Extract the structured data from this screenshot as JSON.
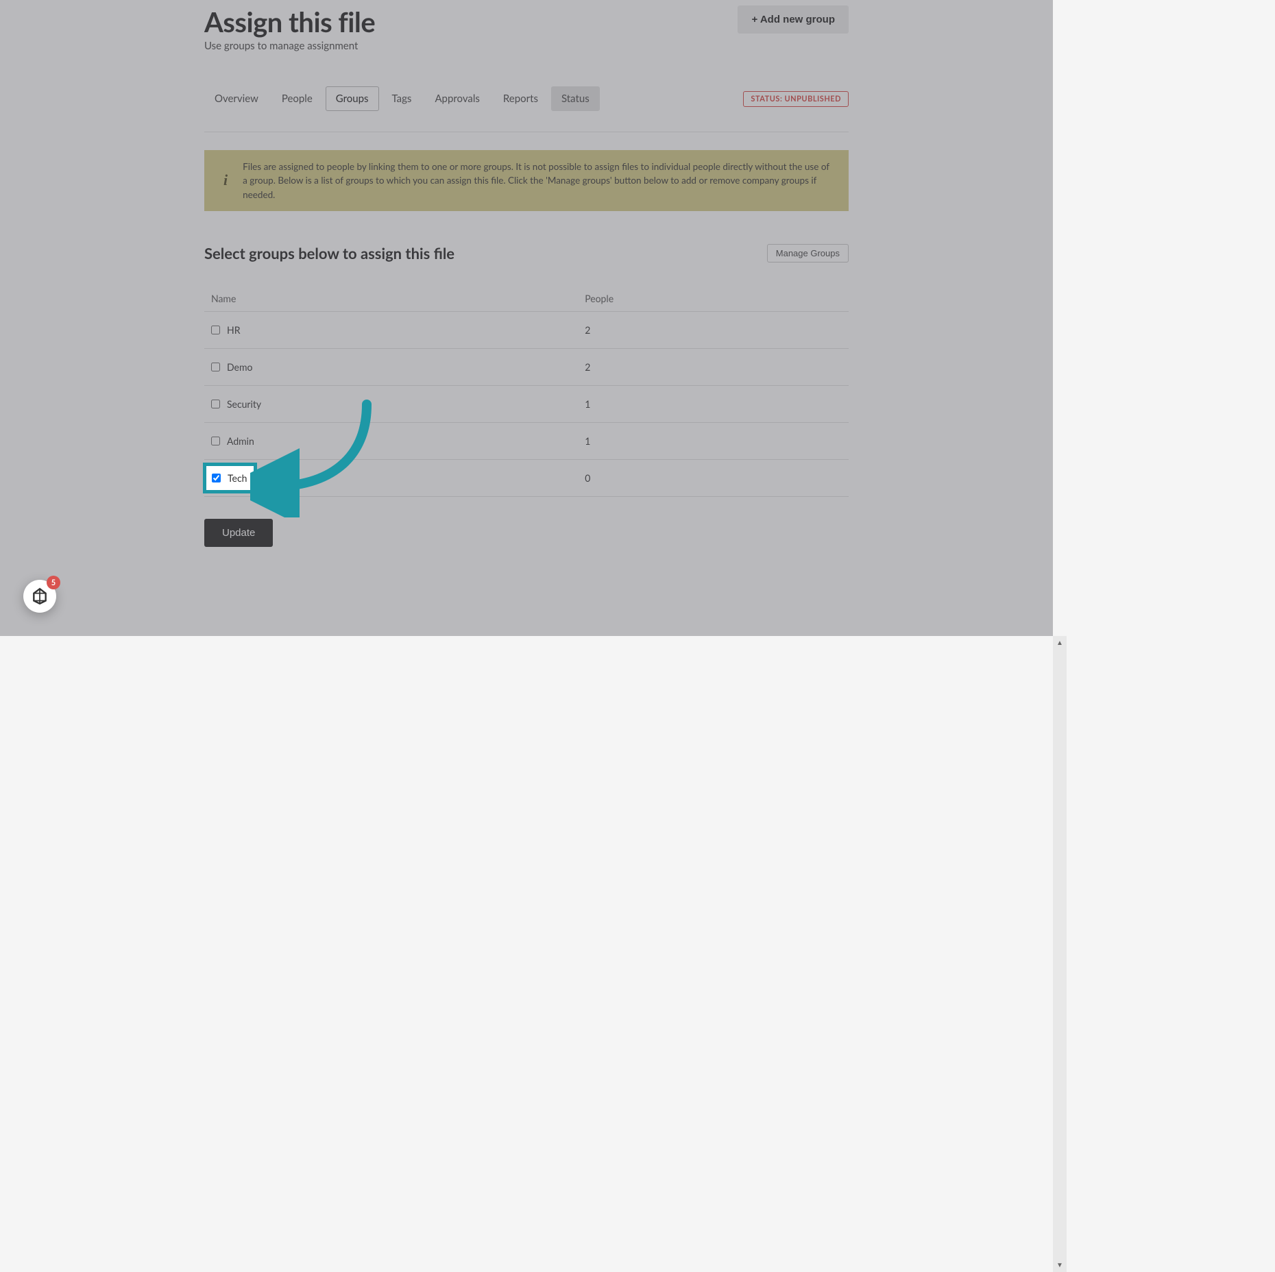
{
  "header": {
    "title": "Assign this file",
    "subtitle": "Use groups to manage assignment",
    "add_group_label": "+ Add new group"
  },
  "tabs": {
    "items": [
      {
        "label": "Overview"
      },
      {
        "label": "People"
      },
      {
        "label": "Groups"
      },
      {
        "label": "Tags"
      },
      {
        "label": "Approvals"
      },
      {
        "label": "Reports"
      },
      {
        "label": "Status"
      }
    ],
    "active_index": 2,
    "status_index": 6
  },
  "status_badge": "STATUS: UNPUBLISHED",
  "info_banner": "Files are assigned to people by linking them to one or more groups. It is not possible to assign files to individual people directly without the use of a group. Below is a list of groups to which you can assign this file. Click the 'Manage groups' button below to add or remove company groups if needed.",
  "section": {
    "title": "Select groups below to assign this file",
    "manage_label": "Manage Groups"
  },
  "table": {
    "headers": {
      "name": "Name",
      "people": "People"
    },
    "rows": [
      {
        "name": "HR",
        "people": "2",
        "checked": false
      },
      {
        "name": "Demo",
        "people": "2",
        "checked": false
      },
      {
        "name": "Security",
        "people": "1",
        "checked": false
      },
      {
        "name": "Admin",
        "people": "1",
        "checked": false
      },
      {
        "name": "Tech",
        "people": "0",
        "checked": true
      }
    ]
  },
  "update_label": "Update",
  "widget": {
    "badge_count": "5"
  },
  "annotation": {
    "highlight_row_index": 4,
    "arrow_color": "#1e98a6"
  }
}
